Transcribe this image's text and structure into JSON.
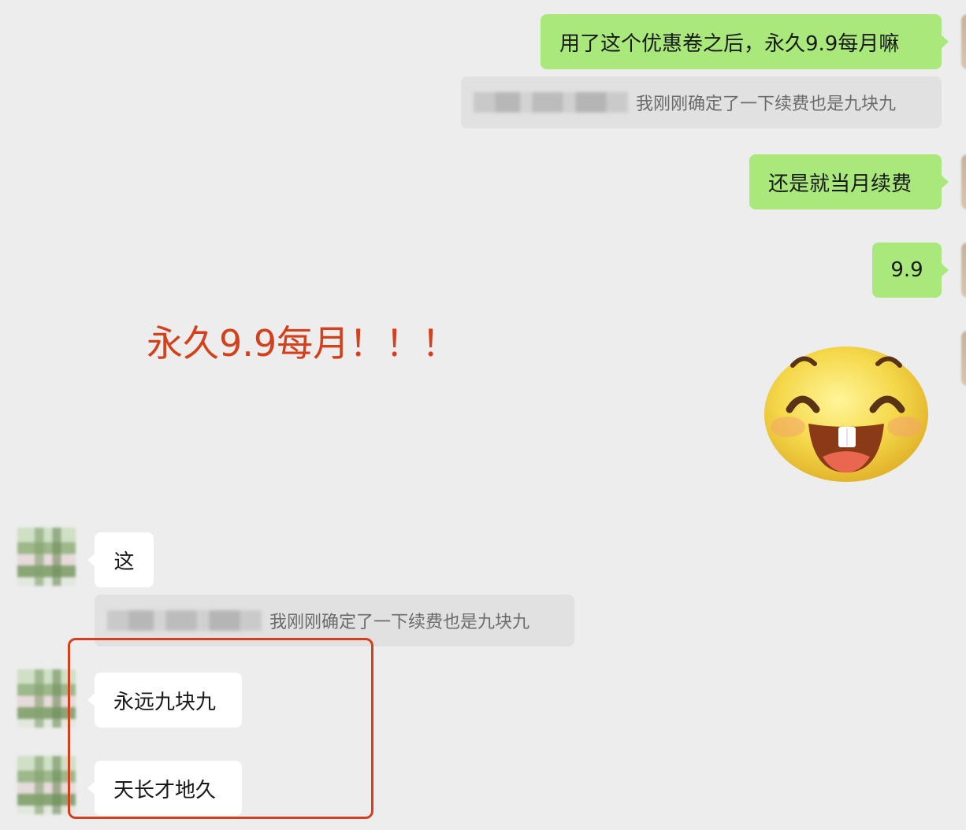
{
  "messages": [
    {
      "sender": "me",
      "text": "用了这个优惠卷之后，永久9.9每月嘛"
    },
    {
      "sender": "me",
      "quote": "我刚刚确定了一下续费也是九块九"
    },
    {
      "sender": "me",
      "text": "还是就当月续费"
    },
    {
      "sender": "me",
      "text": "9.9"
    },
    {
      "sender": "me",
      "sticker": "laughing-face-sticker"
    },
    {
      "sender": "them",
      "text": "这"
    },
    {
      "sender": "them",
      "quote": "我刚刚确定了一下续费也是九块九"
    },
    {
      "sender": "them",
      "text": "永远九块九"
    },
    {
      "sender": "them",
      "text": "天长才地久"
    }
  ],
  "annotation": "永久9.9每月！！！",
  "colors": {
    "background": "#ededed",
    "my_bubble": "#a9e87a",
    "their_bubble": "#ffffff",
    "quote_bg": "#e1e1e1",
    "annotation_red": "#d4401c"
  }
}
